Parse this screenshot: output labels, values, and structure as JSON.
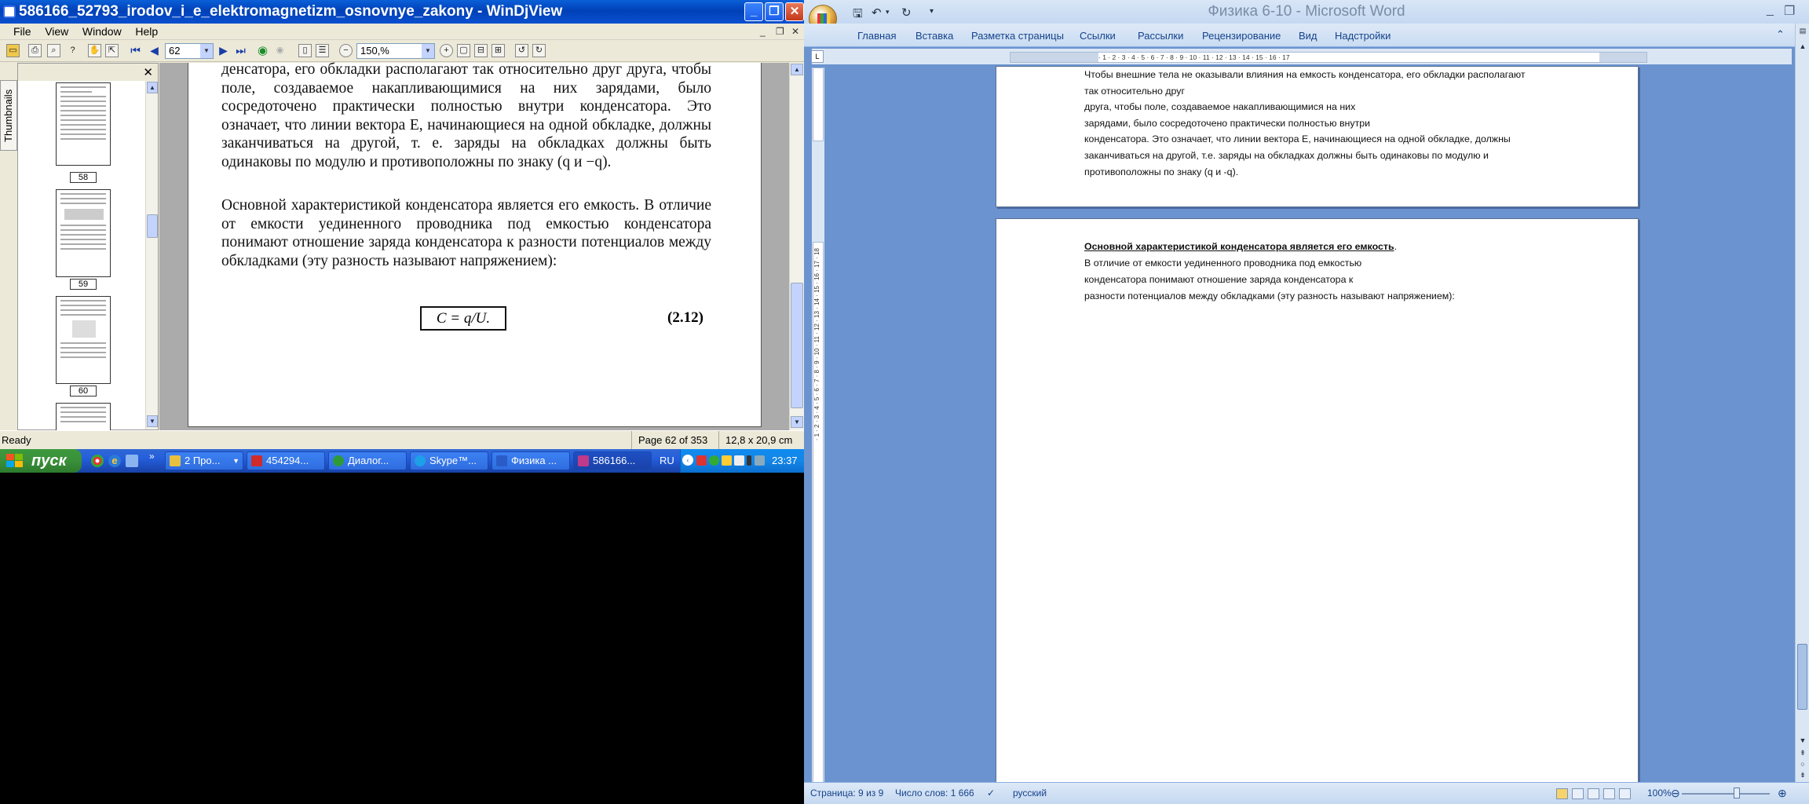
{
  "windjview": {
    "title": "586166_52793_irodov_i_e_elektromagnetizm_osnovnye_zakony - WinDjView",
    "menu": [
      "File",
      "View",
      "Window",
      "Help"
    ],
    "toolbar": {
      "page_value": "62",
      "zoom_value": "150,%"
    },
    "thumbnails": {
      "tab_label": "Thumbnails",
      "pages": [
        "58",
        "59",
        "60"
      ]
    },
    "document": {
      "para1": "денсатора, его обкладки располагают так относительно друг друга, чтобы поле, создаваемое накапливающимися на них зарядами, было сосредоточено практически полностью внутри конденсатора. Это означает, что линии вектора E, начинающиеся на одной обкладке, должны заканчиваться на другой, т. е. заряды на обкладках должны быть одинаковы по модулю и противоположны по знаку (q и −q).",
      "para2": "Основной характеристикой конденсатора является его емкость. В отличие от емкости уединенного проводника под емкостью конденсатора понимают отношение заряда конденсатора к разности потенциалов между обкладками (эту разность называют напряжением):",
      "formula": "C = q/U.",
      "formula_number": "(2.12)"
    },
    "status": {
      "ready": "Ready",
      "page": "Page 62 of 353",
      "size": "12,8 x 20,9 cm"
    }
  },
  "taskbar": {
    "start_label": "пуск",
    "apps": [
      {
        "label": "2 Про...",
        "color": "#e8c040"
      },
      {
        "label": "454294...",
        "color": "#d02a2a"
      },
      {
        "label": "Диалог...",
        "color": "#2f9a3a"
      },
      {
        "label": "Skype™...",
        "color": "#1ea0e8"
      },
      {
        "label": "Физика ...",
        "color": "#2a5cc8"
      },
      {
        "label": "586166...",
        "color": "#c03a8a"
      }
    ],
    "lang": "RU",
    "clock": "23:37"
  },
  "word": {
    "title": "Физика 6-10 - Microsoft Word",
    "tabs": [
      "Главная",
      "Вставка",
      "Разметка страницы",
      "Ссылки",
      "Рассылки",
      "Рецензирование",
      "Вид",
      "Надстройки"
    ],
    "page1_lines": [
      "Чтобы внешние тела не оказывали влияния на емкость конденсатора, его обкладки располагают",
      "так относительно друг",
      "друга, чтобы поле, создаваемое накапливающимися на них",
      "зарядами, было сосредоточено практически полностью внутри",
      "конденсатора. Это означает, что линии вектора E, начинающиеся на одной обкладке, должны",
      "заканчиваться на другой, т.е. заряды на обкладках должны быть одинаковы по модулю и",
      "противоположны по знаку (q и -q)."
    ],
    "page2_heading": "Основной характеристикой конденсатора является его емкость",
    "page2_heading_end": ".",
    "page2_lines": [
      "В отличие от емкости уединенного проводника под емкостью",
      "конденсатора понимают отношение заряда конденсатора к",
      "разности потенциалов между обкладками (эту разность называют напряжением):"
    ],
    "status": {
      "page": "Страница: 9 из 9",
      "words": "Число слов: 1 666",
      "language": "русский",
      "zoom": "100%"
    }
  }
}
